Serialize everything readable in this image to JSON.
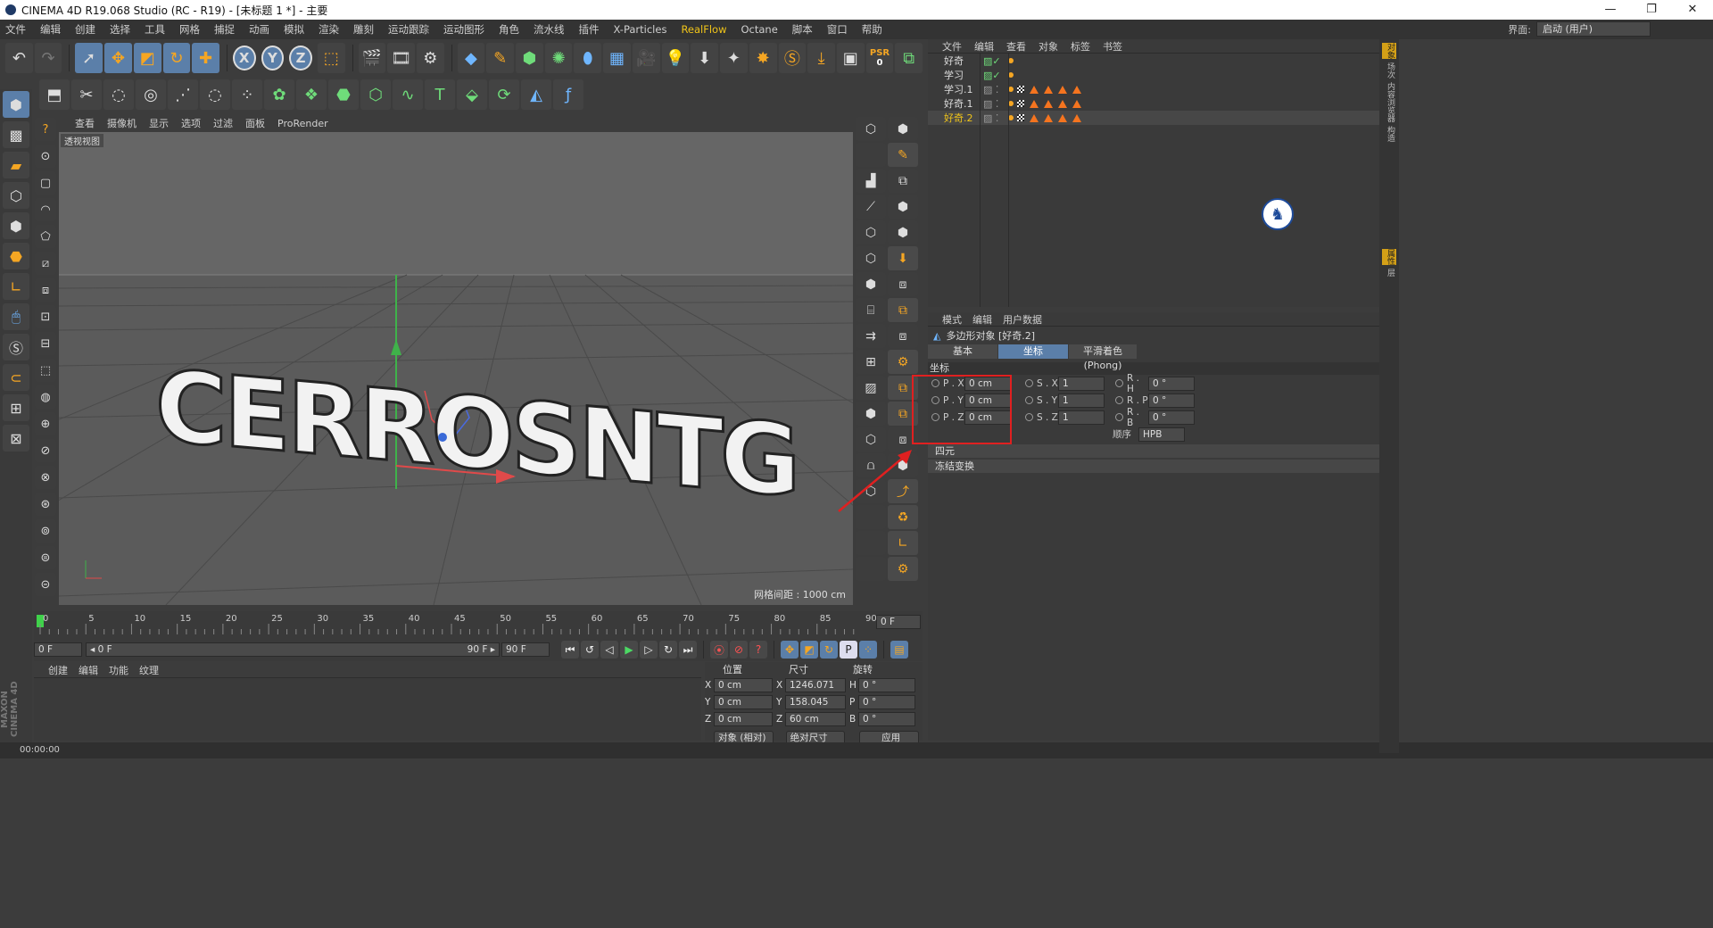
{
  "window": {
    "title": "CINEMA 4D R19.068 Studio (RC - R19) - [未标题 1 *] - 主要",
    "controls": [
      "—",
      "❐",
      "✕"
    ]
  },
  "menu": {
    "items": [
      "文件",
      "编辑",
      "创建",
      "选择",
      "工具",
      "网格",
      "捕捉",
      "动画",
      "模拟",
      "渲染",
      "雕刻",
      "运动跟踪",
      "运动图形",
      "角色",
      "流水线",
      "插件",
      "X-Particles",
      "RealFlow",
      "Octane",
      "脚本",
      "窗口",
      "帮助"
    ],
    "interface_label": "界面:",
    "interface_value": "启动 (用户)"
  },
  "toolbar": {
    "psr_label": "PSR",
    "psr_value": "0"
  },
  "viewport": {
    "menu": [
      "查看",
      "摄像机",
      "显示",
      "选项",
      "过滤",
      "面板",
      "ProRender"
    ],
    "view_label": "透视视图",
    "grid_info": "网格间距 : 1000 cm",
    "text_object": "CERROSNTG"
  },
  "timeline": {
    "ticks": [
      "0",
      "5",
      "10",
      "15",
      "20",
      "25",
      "30",
      "35",
      "40",
      "45",
      "50",
      "55",
      "60",
      "65",
      "70",
      "75",
      "80",
      "85",
      "90"
    ],
    "current_frame": "0 F",
    "start_frame": "0 F",
    "range_start": "◂ 0 F",
    "range_end": "90 F ▸",
    "end_frame": "90 F"
  },
  "material": {
    "menu": [
      "创建",
      "编辑",
      "功能",
      "纹理"
    ]
  },
  "coords": {
    "headers": [
      "位置",
      "尺寸",
      "旋转"
    ],
    "rows": [
      {
        "axis": "X",
        "pos": "0 cm",
        "size_axis": "X",
        "size": "1246.071 cm",
        "rot_axis": "H",
        "rot": "0 °"
      },
      {
        "axis": "Y",
        "pos": "0 cm",
        "size_axis": "Y",
        "size": "158.045 cm",
        "rot_axis": "P",
        "rot": "0 °"
      },
      {
        "axis": "Z",
        "pos": "0 cm",
        "size_axis": "Z",
        "size": "60 cm",
        "rot_axis": "B",
        "rot": "0 °"
      }
    ],
    "mode1": "对象 (相对)",
    "mode2": "绝对尺寸",
    "apply": "应用"
  },
  "status": {
    "time": "00:00:00"
  },
  "object_manager": {
    "menu": [
      "文件",
      "编辑",
      "查看",
      "对象",
      "标签",
      "书签"
    ],
    "objects": [
      {
        "name": "好奇",
        "type": "text",
        "selected": false,
        "tags": 1
      },
      {
        "name": "学习",
        "type": "text",
        "selected": false,
        "tags": 1
      },
      {
        "name": "学习.1",
        "type": "poly",
        "selected": false,
        "tags": 5
      },
      {
        "name": "好奇.1",
        "type": "poly",
        "selected": false,
        "tags": 5
      },
      {
        "name": "好奇.2",
        "type": "poly",
        "selected": true,
        "tags": 5
      }
    ]
  },
  "attributes": {
    "menu": [
      "模式",
      "编辑",
      "用户数据"
    ],
    "object_line": "多边形对象 [好奇.2]",
    "tabs": [
      "基本",
      "坐标",
      "平滑着色(Phong)"
    ],
    "active_tab": "坐标",
    "section": "坐标",
    "rows": [
      {
        "p_label": "P . X",
        "p": "0 cm",
        "s_label": "S . X",
        "s": "1",
        "r_label": "R . H",
        "r": "0 °"
      },
      {
        "p_label": "P . Y",
        "p": "0 cm",
        "s_label": "S . Y",
        "s": "1",
        "r_label": "R . P",
        "r": "0 °"
      },
      {
        "p_label": "P . Z",
        "p": "0 cm",
        "s_label": "S . Z",
        "s": "1",
        "r_label": "R . B",
        "r": "0 °"
      }
    ],
    "order_label": "顺序",
    "order_value": "HPB",
    "folds": [
      "四元",
      "冻结变换"
    ]
  },
  "side_tabs": [
    "对象",
    "场次",
    "内容浏览器",
    "构造",
    "属性",
    "层"
  ],
  "colors": {
    "accent": "#5b7fa9",
    "highlight": "#f0c419",
    "annotation": "#e02020"
  }
}
